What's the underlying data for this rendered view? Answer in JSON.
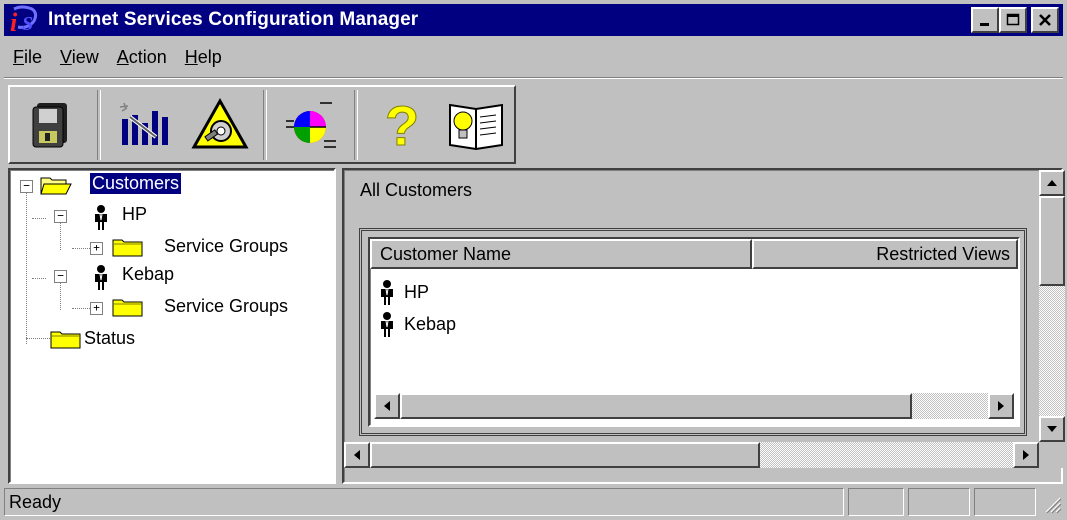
{
  "window": {
    "title": "Internet Services Configuration Manager",
    "title_bar_color": "#000080",
    "buttons": {
      "minimize_icon": "minimize-icon",
      "maximize_icon": "maximize-icon",
      "close_icon": "close-icon"
    }
  },
  "menu": {
    "items": [
      {
        "label": "File",
        "underline": "F",
        "rest": "ile"
      },
      {
        "label": "View",
        "underline": "V",
        "rest": "iew"
      },
      {
        "label": "Action",
        "underline": "A",
        "rest": "ction"
      },
      {
        "label": "Help",
        "underline": "H",
        "rest": "elp"
      }
    ]
  },
  "toolbar": {
    "buttons": [
      {
        "icon": "save-disk-icon"
      },
      {
        "icon": "chart-wizard-icon"
      },
      {
        "icon": "warning-wrench-icon"
      },
      {
        "icon": "pie-chart-icon"
      },
      {
        "icon": "help-question-icon"
      },
      {
        "icon": "book-lightbulb-icon"
      }
    ]
  },
  "tree": {
    "root": {
      "label": "Customers",
      "expander": "−"
    },
    "customers": [
      {
        "label": "HP",
        "expander": "−",
        "child": {
          "label": "Service Groups",
          "expander": "+"
        }
      },
      {
        "label": "Kebap",
        "expander": "−",
        "child": {
          "label": "Service Groups",
          "expander": "+"
        }
      }
    ],
    "status": {
      "label": "Status"
    }
  },
  "content": {
    "heading": "All Customers",
    "columns": [
      "Customer Name",
      "Restricted Views"
    ],
    "rows": [
      "HP",
      "Kebap"
    ]
  },
  "statusbar": {
    "text": "Ready"
  }
}
